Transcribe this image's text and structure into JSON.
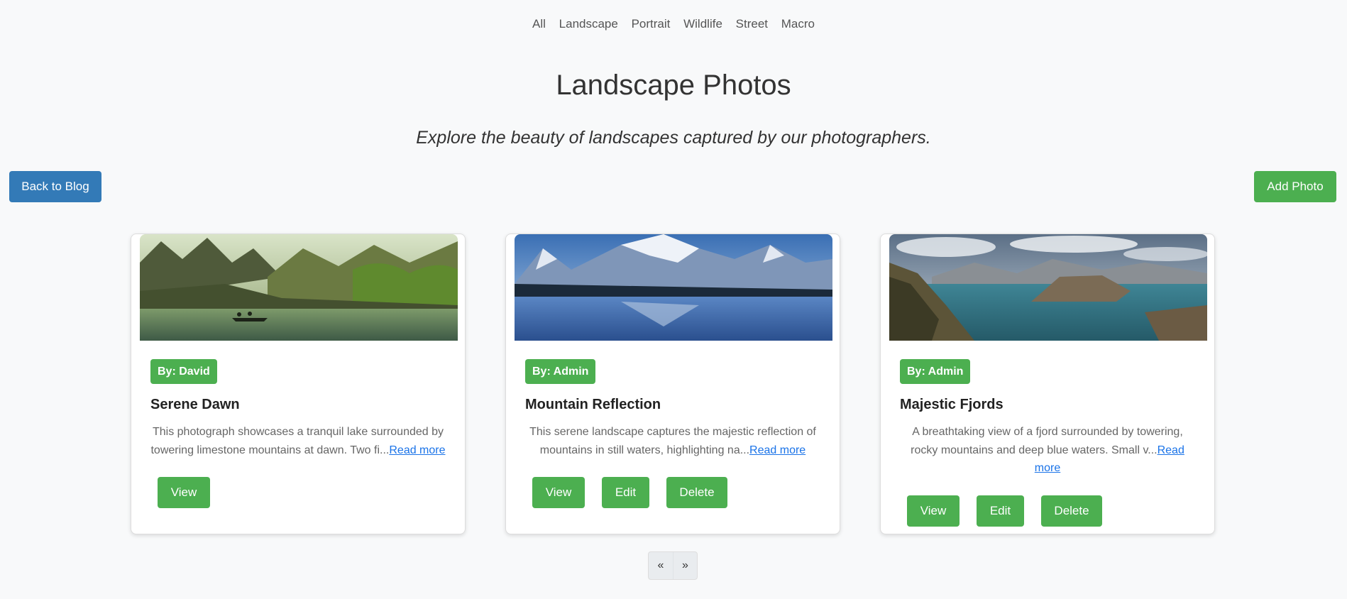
{
  "nav": {
    "categories": [
      "All",
      "Landscape",
      "Portrait",
      "Wildlife",
      "Street",
      "Macro"
    ]
  },
  "header": {
    "title": "Landscape Photos",
    "subtitle": "Explore the beauty of landscapes captured by our photographers."
  },
  "toolbar": {
    "back_label": "Back to Blog",
    "add_label": "Add Photo"
  },
  "cards": [
    {
      "author": "By: David",
      "title": "Serene Dawn",
      "excerpt": "This photograph showcases a tranquil lake surrounded by towering limestone mountains at dawn. Two fi...",
      "read_more": "Read more",
      "view_label": "View"
    },
    {
      "author": "By: Admin",
      "title": "Mountain Reflection",
      "excerpt": "This serene landscape captures the majestic reflection of mountains in still waters, highlighting na...",
      "read_more": "Read more",
      "view_label": "View",
      "edit_label": "Edit",
      "delete_label": "Delete"
    },
    {
      "author": "By: Admin",
      "title": "Majestic Fjords",
      "excerpt": "A breathtaking view of a fjord surrounded by towering, rocky mountains and deep blue waters. Small v...",
      "read_more": "Read more",
      "view_label": "View",
      "edit_label": "Edit",
      "delete_label": "Delete"
    }
  ],
  "pagination": {
    "prev": "«",
    "next": "»"
  },
  "colors": {
    "accent_green": "#4caf50",
    "accent_blue": "#337ab7",
    "link": "#1a73e8",
    "background": "#f8f9fa"
  }
}
